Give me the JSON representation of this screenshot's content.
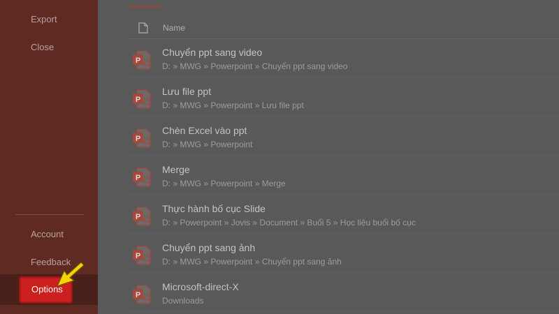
{
  "sidebar": {
    "top_items": [
      "Export",
      "Close"
    ],
    "bottom_items": [
      "Account",
      "Feedback"
    ],
    "options_label": "Options"
  },
  "list": {
    "column_name": "Name",
    "files": [
      {
        "name": "Chuyển ppt sang video",
        "path": "D: » MWG » Powerpoint » Chuyển ppt sang video"
      },
      {
        "name": "Lưu file ppt",
        "path": "D: » MWG » Powerpoint » Lưu file ppt"
      },
      {
        "name": "Chèn Excel vào ppt",
        "path": "D: » MWG » Powerpoint"
      },
      {
        "name": "Merge",
        "path": "D: » MWG » Powerpoint » Merge"
      },
      {
        "name": "Thực hành bố cục Slide",
        "path": "D: » Powerpoint » Jovis » Document » Buổi 5 » Học liệu buổi bố cục"
      },
      {
        "name": "Chuyển ppt sang ảnh",
        "path": "D: » MWG » Powerpoint » Chuyển ppt sang ảnh"
      },
      {
        "name": "Microsoft-direct-X",
        "path": "Downloads"
      }
    ]
  },
  "colors": {
    "sidebar_bg": "#5e2a22",
    "options_highlight": "#cc1f1f",
    "pointer_arrow": "#f5d400",
    "ppt_icon": "#a0493c"
  },
  "icons": {
    "header": "document-icon",
    "file": "powerpoint-file-icon",
    "pointer": "pointer-arrow-icon"
  }
}
